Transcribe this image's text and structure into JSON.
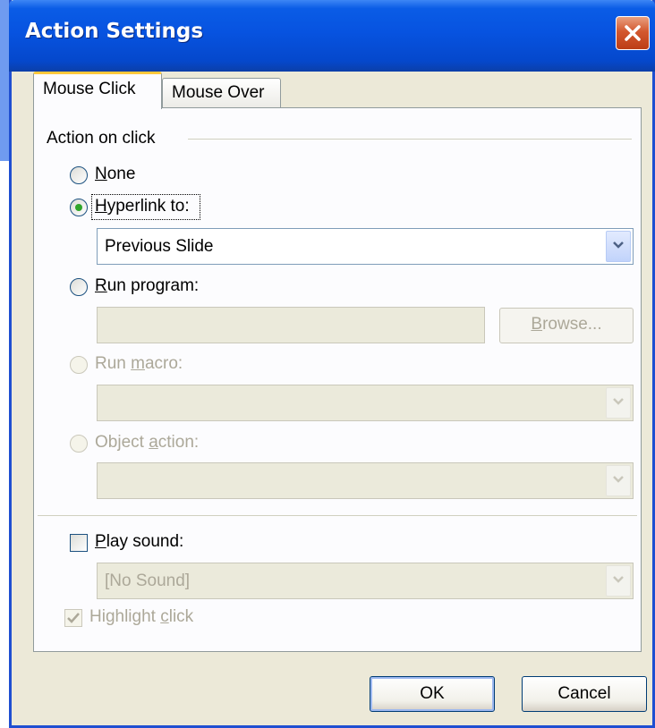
{
  "window": {
    "title": "Action Settings",
    "close_icon": "close-icon"
  },
  "tabs": [
    {
      "label": "Mouse Click",
      "active": true
    },
    {
      "label": "Mouse Over",
      "active": false
    }
  ],
  "group": {
    "title": "Action on click"
  },
  "options": {
    "none": {
      "label": "None",
      "selected": false,
      "enabled": true
    },
    "hyperlink": {
      "label": "Hyperlink to:",
      "selected": true,
      "enabled": true,
      "value": "Previous Slide"
    },
    "run_program": {
      "label": "Run program:",
      "selected": false,
      "enabled": true,
      "value": "",
      "browse_label": "Browse..."
    },
    "run_macro": {
      "label": "Run macro:",
      "selected": false,
      "enabled": false,
      "value": ""
    },
    "object_action": {
      "label": "Object action:",
      "selected": false,
      "enabled": false,
      "value": ""
    }
  },
  "sound": {
    "label": "Play sound:",
    "checked": false,
    "value": "[No Sound]"
  },
  "highlight": {
    "label": "Highlight click",
    "checked": true,
    "enabled": false
  },
  "buttons": {
    "ok": "OK",
    "cancel": "Cancel"
  },
  "colors": {
    "titlebar": "#0753e0",
    "dialog_bg": "#ece9d8",
    "active_tab_accent": "#ffc83c",
    "radio_dot": "#2fa52a",
    "close_button": "#d3582f"
  }
}
